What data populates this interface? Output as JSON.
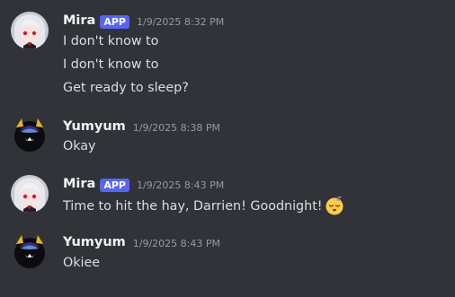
{
  "messages": [
    {
      "author": "Mira",
      "badge": "APP",
      "timestamp": "1/9/2025 8:32 PM",
      "avatar": "anime-girl-avatar",
      "lines": [
        "I don't know to",
        "I don't know to",
        "Get ready to sleep?"
      ]
    },
    {
      "author": "Yumyum",
      "timestamp": "1/9/2025 8:38 PM",
      "avatar": "dark-creature-avatar",
      "lines": [
        "Okay"
      ]
    },
    {
      "author": "Mira",
      "badge": "APP",
      "timestamp": "1/9/2025 8:43 PM",
      "avatar": "anime-girl-avatar",
      "lines": [
        "Time to hit the hay, Darrien! Goodnight!"
      ],
      "emoji": "sleeping-face-emoji"
    },
    {
      "author": "Yumyum",
      "timestamp": "1/9/2025 8:43 PM",
      "avatar": "dark-creature-avatar",
      "lines": [
        "Okiee"
      ]
    }
  ],
  "colors": {
    "background": "#313338",
    "username": "#f2f3f5",
    "message_text": "#dbdee1",
    "timestamp": "#949ba4",
    "app_badge": "#5865f2"
  }
}
